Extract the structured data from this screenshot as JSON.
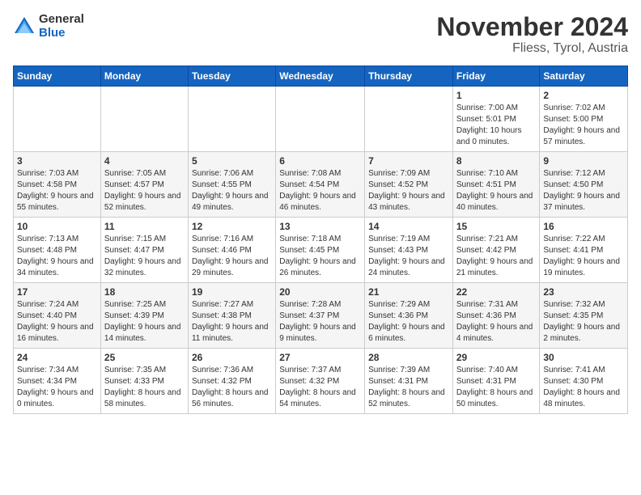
{
  "logo": {
    "general": "General",
    "blue": "Blue"
  },
  "title": {
    "month_year": "November 2024",
    "location": "Fliess, Tyrol, Austria"
  },
  "weekdays": [
    "Sunday",
    "Monday",
    "Tuesday",
    "Wednesday",
    "Thursday",
    "Friday",
    "Saturday"
  ],
  "weeks": [
    {
      "row_class": "week-row-odd",
      "days": [
        {
          "num": "",
          "detail": "",
          "empty": true
        },
        {
          "num": "",
          "detail": "",
          "empty": true
        },
        {
          "num": "",
          "detail": "",
          "empty": true
        },
        {
          "num": "",
          "detail": "",
          "empty": true
        },
        {
          "num": "",
          "detail": "",
          "empty": true
        },
        {
          "num": "1",
          "detail": "Sunrise: 7:00 AM\nSunset: 5:01 PM\nDaylight: 10 hours and 0 minutes."
        },
        {
          "num": "2",
          "detail": "Sunrise: 7:02 AM\nSunset: 5:00 PM\nDaylight: 9 hours and 57 minutes."
        }
      ]
    },
    {
      "row_class": "week-row-even",
      "days": [
        {
          "num": "3",
          "detail": "Sunrise: 7:03 AM\nSunset: 4:58 PM\nDaylight: 9 hours and 55 minutes."
        },
        {
          "num": "4",
          "detail": "Sunrise: 7:05 AM\nSunset: 4:57 PM\nDaylight: 9 hours and 52 minutes."
        },
        {
          "num": "5",
          "detail": "Sunrise: 7:06 AM\nSunset: 4:55 PM\nDaylight: 9 hours and 49 minutes."
        },
        {
          "num": "6",
          "detail": "Sunrise: 7:08 AM\nSunset: 4:54 PM\nDaylight: 9 hours and 46 minutes."
        },
        {
          "num": "7",
          "detail": "Sunrise: 7:09 AM\nSunset: 4:52 PM\nDaylight: 9 hours and 43 minutes."
        },
        {
          "num": "8",
          "detail": "Sunrise: 7:10 AM\nSunset: 4:51 PM\nDaylight: 9 hours and 40 minutes."
        },
        {
          "num": "9",
          "detail": "Sunrise: 7:12 AM\nSunset: 4:50 PM\nDaylight: 9 hours and 37 minutes."
        }
      ]
    },
    {
      "row_class": "week-row-odd",
      "days": [
        {
          "num": "10",
          "detail": "Sunrise: 7:13 AM\nSunset: 4:48 PM\nDaylight: 9 hours and 34 minutes."
        },
        {
          "num": "11",
          "detail": "Sunrise: 7:15 AM\nSunset: 4:47 PM\nDaylight: 9 hours and 32 minutes."
        },
        {
          "num": "12",
          "detail": "Sunrise: 7:16 AM\nSunset: 4:46 PM\nDaylight: 9 hours and 29 minutes."
        },
        {
          "num": "13",
          "detail": "Sunrise: 7:18 AM\nSunset: 4:45 PM\nDaylight: 9 hours and 26 minutes."
        },
        {
          "num": "14",
          "detail": "Sunrise: 7:19 AM\nSunset: 4:43 PM\nDaylight: 9 hours and 24 minutes."
        },
        {
          "num": "15",
          "detail": "Sunrise: 7:21 AM\nSunset: 4:42 PM\nDaylight: 9 hours and 21 minutes."
        },
        {
          "num": "16",
          "detail": "Sunrise: 7:22 AM\nSunset: 4:41 PM\nDaylight: 9 hours and 19 minutes."
        }
      ]
    },
    {
      "row_class": "week-row-even",
      "days": [
        {
          "num": "17",
          "detail": "Sunrise: 7:24 AM\nSunset: 4:40 PM\nDaylight: 9 hours and 16 minutes."
        },
        {
          "num": "18",
          "detail": "Sunrise: 7:25 AM\nSunset: 4:39 PM\nDaylight: 9 hours and 14 minutes."
        },
        {
          "num": "19",
          "detail": "Sunrise: 7:27 AM\nSunset: 4:38 PM\nDaylight: 9 hours and 11 minutes."
        },
        {
          "num": "20",
          "detail": "Sunrise: 7:28 AM\nSunset: 4:37 PM\nDaylight: 9 hours and 9 minutes."
        },
        {
          "num": "21",
          "detail": "Sunrise: 7:29 AM\nSunset: 4:36 PM\nDaylight: 9 hours and 6 minutes."
        },
        {
          "num": "22",
          "detail": "Sunrise: 7:31 AM\nSunset: 4:36 PM\nDaylight: 9 hours and 4 minutes."
        },
        {
          "num": "23",
          "detail": "Sunrise: 7:32 AM\nSunset: 4:35 PM\nDaylight: 9 hours and 2 minutes."
        }
      ]
    },
    {
      "row_class": "week-row-odd",
      "days": [
        {
          "num": "24",
          "detail": "Sunrise: 7:34 AM\nSunset: 4:34 PM\nDaylight: 9 hours and 0 minutes."
        },
        {
          "num": "25",
          "detail": "Sunrise: 7:35 AM\nSunset: 4:33 PM\nDaylight: 8 hours and 58 minutes."
        },
        {
          "num": "26",
          "detail": "Sunrise: 7:36 AM\nSunset: 4:32 PM\nDaylight: 8 hours and 56 minutes."
        },
        {
          "num": "27",
          "detail": "Sunrise: 7:37 AM\nSunset: 4:32 PM\nDaylight: 8 hours and 54 minutes."
        },
        {
          "num": "28",
          "detail": "Sunrise: 7:39 AM\nSunset: 4:31 PM\nDaylight: 8 hours and 52 minutes."
        },
        {
          "num": "29",
          "detail": "Sunrise: 7:40 AM\nSunset: 4:31 PM\nDaylight: 8 hours and 50 minutes."
        },
        {
          "num": "30",
          "detail": "Sunrise: 7:41 AM\nSunset: 4:30 PM\nDaylight: 8 hours and 48 minutes."
        }
      ]
    }
  ]
}
